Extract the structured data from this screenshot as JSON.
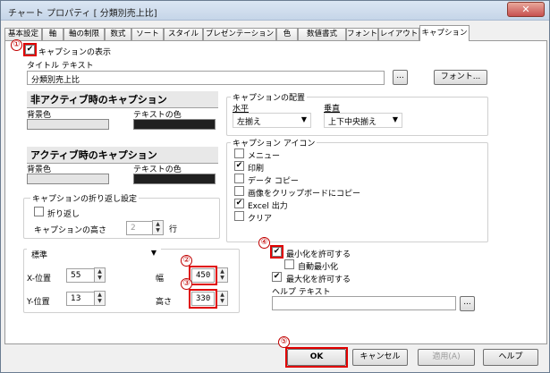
{
  "window": {
    "title": "チャート プロパティ [ 分類別売上比]",
    "close": "✕"
  },
  "tabs": [
    "基本設定",
    "軸",
    "軸の制限",
    "数式",
    "ソート",
    "スタイル",
    "プレゼンテーション",
    "色",
    "数値書式",
    "フォント",
    "レイアウト",
    "キャプション"
  ],
  "caption_show": {
    "label": "キャプションの表示",
    "checked": true
  },
  "title_text": {
    "label": "タイトル テキスト",
    "value": "分類別売上比",
    "ellipsis": "...",
    "font_button": "フォント..."
  },
  "inactive": {
    "header": "非アクティブ時のキャプション",
    "bg_label": "背景色",
    "text_color_label": "テキストの色"
  },
  "active": {
    "header": "アクティブ時のキャプション",
    "bg_label": "背景色",
    "text_color_label": "テキストの色"
  },
  "wrap": {
    "group_title": "キャプションの折り返し設定",
    "wrap_label": "折り返し",
    "height_label": "キャプションの高さ",
    "height_value": "2",
    "unit": "行"
  },
  "alignment": {
    "group_title": "キャプションの配置",
    "horizontal_label": "水平",
    "horizontal_value": "左揃え",
    "vertical_label": "垂直",
    "vertical_value": "上下中央揃え"
  },
  "caption_icons": {
    "group_title": "キャプション アイコン",
    "items": [
      {
        "label": "メニュー",
        "checked": false
      },
      {
        "label": "印刷",
        "checked": true
      },
      {
        "label": "データ コピー",
        "checked": false
      },
      {
        "label": "画像をクリップボードにコピー",
        "checked": false
      },
      {
        "label": "Excel 出力",
        "checked": true
      },
      {
        "label": "クリア",
        "checked": false
      }
    ]
  },
  "position": {
    "mode": "標準",
    "x_label": "X-位置",
    "x_value": "55",
    "y_label": "Y-位置",
    "y_value": "13",
    "width_label": "幅",
    "width_value": "450",
    "height_label": "高さ",
    "height_value": "330"
  },
  "window_opts": {
    "minimize_label": "最小化を許可する",
    "minimize_checked": true,
    "auto_min_label": "自動最小化",
    "auto_min_checked": false,
    "maximize_label": "最大化を許可する",
    "maximize_checked": true,
    "help_label": "ヘルプ テキスト",
    "help_value": "",
    "ellipsis": "..."
  },
  "annotations": [
    "①",
    "②",
    "③",
    "④",
    "⑤"
  ],
  "buttons": {
    "ok": "OK",
    "cancel": "キャンセル",
    "apply": "適用(A)",
    "help": "ヘルプ"
  },
  "colors": {
    "accent_red": "#e00000",
    "swatch_light": "#e4e4e4",
    "swatch_dark": "#202020"
  },
  "check_mark": "✔"
}
